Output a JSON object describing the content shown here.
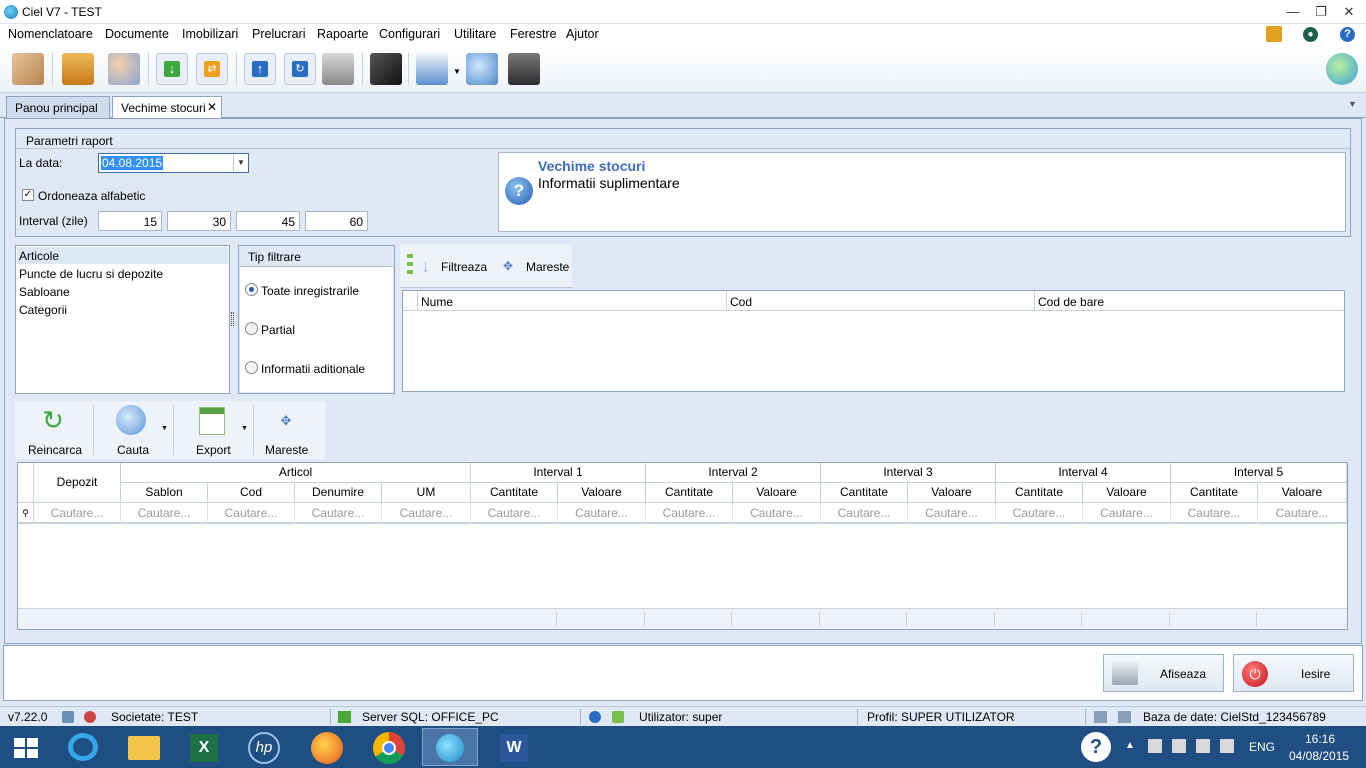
{
  "window": {
    "title": "Ciel V7 - TEST"
  },
  "menu": [
    "Nomenclatoare",
    "Documente",
    "Imobilizari",
    "Prelucrari",
    "Rapoarte",
    "Configurari",
    "Utilitare",
    "Ferestre",
    "Ajutor"
  ],
  "tabs": {
    "main": "Panou principal",
    "active": "Vechime stocuri"
  },
  "params": {
    "group_title": "Parametri raport",
    "date_label": "La data:",
    "date_value": "04.08.2015",
    "sort_label": "Ordoneaza alfabetic",
    "sort_checked": true,
    "interval_label": "Interval (zile)",
    "intervals": [
      "15",
      "30",
      "45",
      "60"
    ]
  },
  "info": {
    "title": "Vechime stocuri",
    "subtitle": "Informatii suplimentare"
  },
  "filter_list": {
    "items": [
      "Articole",
      "Puncte de lucru si depozite",
      "Sabloane",
      "Categorii"
    ]
  },
  "filter_type": {
    "title": "Tip filtrare",
    "options": [
      "Toate inregistrarile",
      "Partial",
      "Informatii aditionale"
    ],
    "selected": "Toate inregistrarile"
  },
  "filter_tools": {
    "filter": "Filtreaza",
    "expand": "Mareste"
  },
  "filter_grid": {
    "columns": [
      "Nume",
      "Cod",
      "Cod de bare"
    ]
  },
  "report_toolbar": {
    "reload": "Reincarca",
    "search": "Cauta",
    "export": "Export",
    "expand": "Mareste"
  },
  "report_grid": {
    "depozit": "Depozit",
    "articol": "Articol",
    "articol_cols": [
      "Sablon",
      "Cod",
      "Denumire",
      "UM"
    ],
    "intervals": [
      "Interval 1",
      "Interval 2",
      "Interval 3",
      "Interval 4",
      "Interval 5"
    ],
    "interval_cols": [
      "Cantitate",
      "Valoare"
    ],
    "search_placeholder": "Cautare..."
  },
  "buttons": {
    "show": "Afiseaza",
    "exit": "Iesire"
  },
  "status": {
    "version": "v7.22.0",
    "company": "Societate: TEST",
    "server": "Server SQL: OFFICE_PC",
    "user": "Utilizator: super",
    "profile": "Profil: SUPER UTILIZATOR",
    "database": "Baza de date: CielStd_123456789"
  },
  "taskbar": {
    "lang": "ENG",
    "time": "16:16",
    "date": "04/08/2015"
  },
  "colors": {
    "accent": "#2a5ea8",
    "panel_border": "#8ea3bf",
    "background": "#dfe9f5",
    "exit_red": "#d8262a"
  }
}
